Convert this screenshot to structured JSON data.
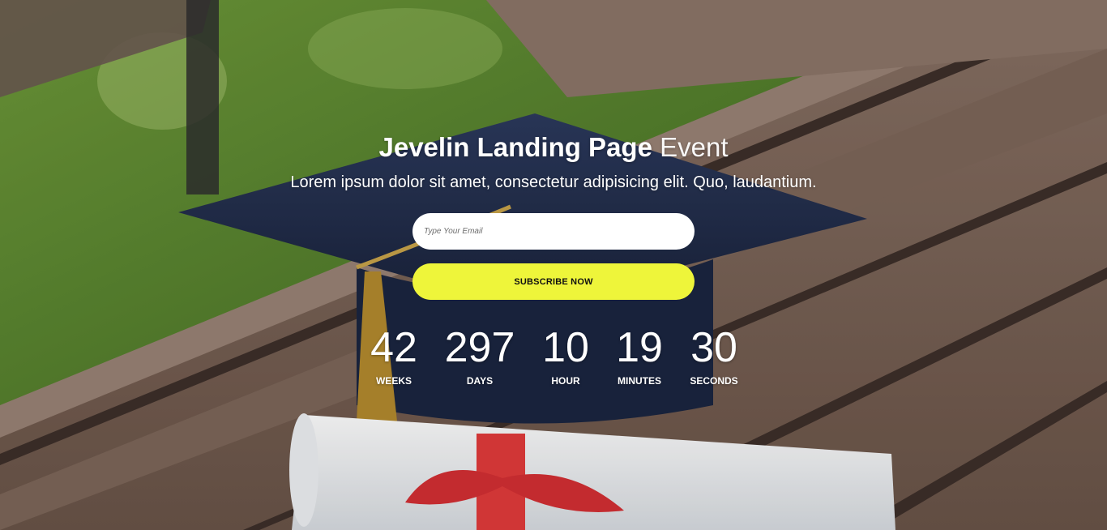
{
  "hero": {
    "title_bold": "Jevelin Landing Page",
    "title_light": "Event",
    "subtitle": "Lorem ipsum dolor sit amet, consectetur adipisicing elit. Quo, laudantium."
  },
  "form": {
    "email_placeholder": "Type Your Email",
    "email_value": "",
    "subscribe_label": "SUBSCRIBE NOW"
  },
  "countdown": [
    {
      "value": "42",
      "label": "WEEKS"
    },
    {
      "value": "297",
      "label": "DAYS"
    },
    {
      "value": "10",
      "label": "HOUR"
    },
    {
      "value": "19",
      "label": "MINUTES"
    },
    {
      "value": "30",
      "label": "SECONDS"
    }
  ],
  "colors": {
    "button_bg": "#eef53a",
    "text": "#ffffff",
    "input_bg": "#ffffff"
  }
}
